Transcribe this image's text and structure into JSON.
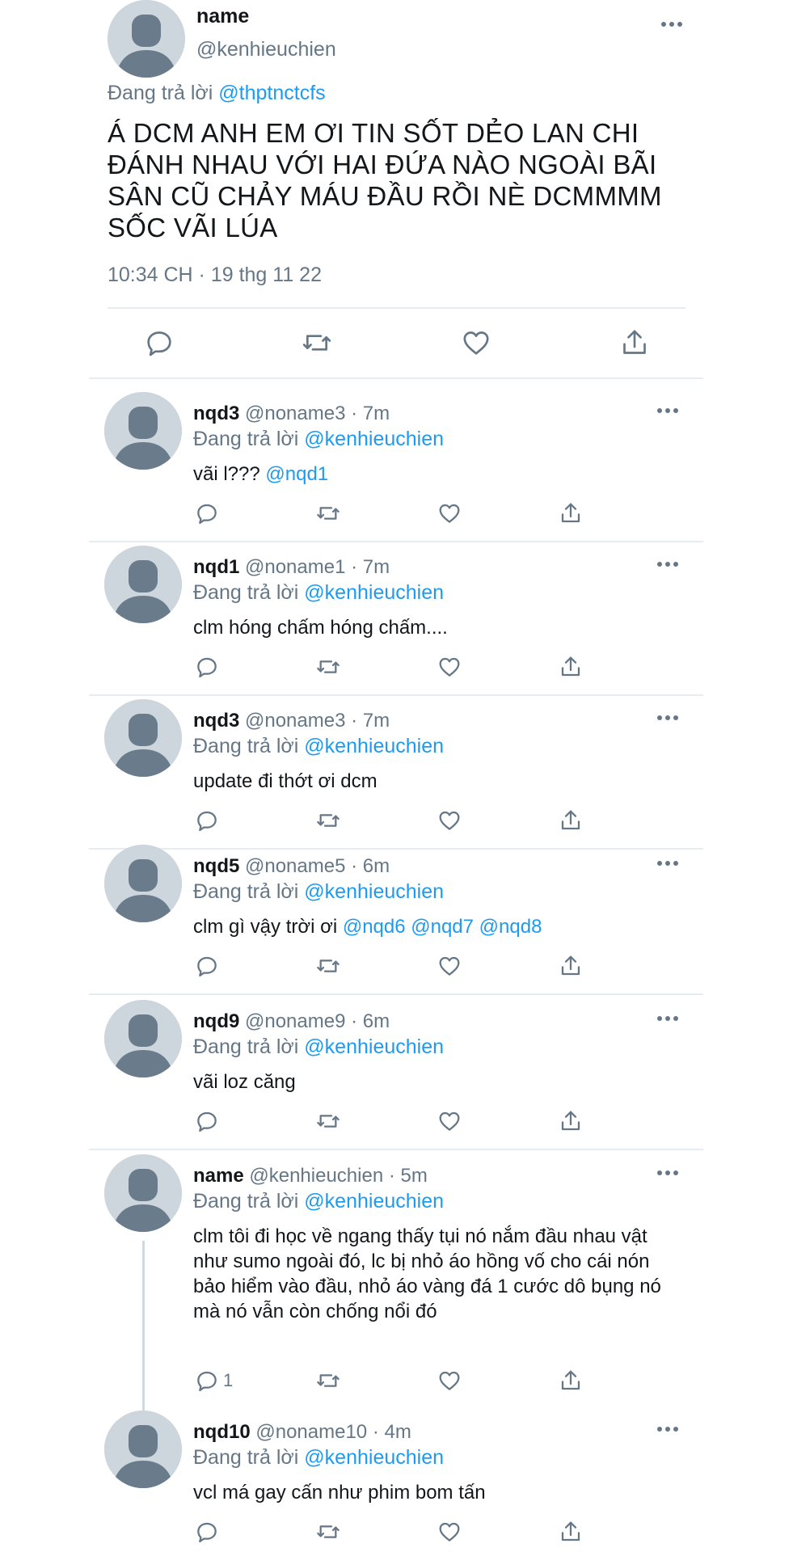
{
  "main_tweet": {
    "name": "name",
    "handle": "@kenhieuchien",
    "replying_prefix": "Đang trả lời",
    "replying_to": "@thptnctcfs",
    "text": "Á DCM ANH EM ƠI TIN SỐT DẺO LAN CHI ĐÁNH NHAU VỚI HAI ĐỨA NÀO NGOÀI BÃI SÂN CŨ CHẢY MÁU ĐẦU RỒI NÈ DCMMMM SỐC VÃI LÚA",
    "timestamp": "10:34 CH · 19 thg 11 22",
    "actions": [
      "reply-icon",
      "retweet-icon",
      "like-icon",
      "share-icon"
    ]
  },
  "replies": [
    {
      "name": "nqd3",
      "meta": "@noname3 · 7m",
      "replying_prefix": "Đang trả lời",
      "replying_to": "@kenhieuchien",
      "text": "vãi l??? ",
      "mentions": "@nqd1",
      "reply_count": ""
    },
    {
      "name": "nqd1",
      "meta": "@noname1 · 7m",
      "replying_prefix": "Đang trả lời",
      "replying_to": "@kenhieuchien",
      "text": "clm hóng chấm hóng chấm....",
      "mentions": "",
      "reply_count": ""
    },
    {
      "name": "nqd3",
      "meta": "@noname3 · 7m",
      "replying_prefix": "Đang trả lời",
      "replying_to": "@kenhieuchien",
      "text": "update đi thớt ơi dcm",
      "mentions": "",
      "reply_count": ""
    },
    {
      "name": "nqd5",
      "meta": "@noname5 · 6m",
      "replying_prefix": "Đang trả lời",
      "replying_to": "@kenhieuchien",
      "text": "clm gì vậy trời ơi ",
      "mentions": "@nqd6 @nqd7 @nqd8",
      "reply_count": ""
    },
    {
      "name": "nqd9",
      "meta": "@noname9 · 6m",
      "replying_prefix": "Đang trả lời",
      "replying_to": "@kenhieuchien",
      "text": "vãi loz căng",
      "mentions": "",
      "reply_count": ""
    },
    {
      "name": "name",
      "meta": "@kenhieuchien · 5m",
      "replying_prefix": "Đang trả lời",
      "replying_to": "@kenhieuchien",
      "text": "clm tôi đi học về ngang thấy tụi nó nắm đầu nhau vật như sumo ngoài đó, lc bị nhỏ áo hồng vố cho cái nón bảo hiểm vào đầu, nhỏ áo vàng đá 1 cước dô bụng nó mà nó vẫn còn chống nổi đó",
      "mentions": "",
      "reply_count": "1"
    },
    {
      "name": "nqd10",
      "meta": "@noname10 · 4m",
      "replying_prefix": "Đang trả lời",
      "replying_to": "@kenhieuchien",
      "text": "vcl má gay cấn như phim bom tấn",
      "mentions": "",
      "reply_count": ""
    }
  ],
  "colors": {
    "link": "#1d9bf0",
    "secondary_text": "#657786",
    "icon": "#657786",
    "divider": "#e6ecf0",
    "avatar_bg": "#cdd6dd",
    "avatar_fg": "#6a7b8c"
  }
}
